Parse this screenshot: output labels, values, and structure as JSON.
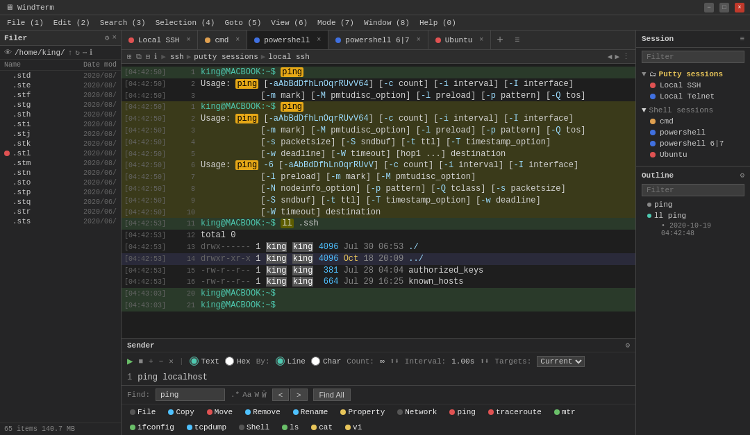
{
  "titlebar": {
    "title": "WindTerm",
    "min_label": "−",
    "max_label": "□",
    "close_label": "×"
  },
  "menubar": {
    "items": [
      "File (1)",
      "Edit (2)",
      "Search (3)",
      "Selection (4)",
      "Goto (5)",
      "View (6)",
      "Mode (7)",
      "Window (8)",
      "Help (0)"
    ]
  },
  "filepanel": {
    "title": "Filer",
    "path": "/home/king/",
    "col_name": "Name",
    "col_date": "Date mod",
    "files": [
      {
        "name": ".std",
        "date": "2020/08/"
      },
      {
        "name": ".ste",
        "date": "2020/08/"
      },
      {
        "name": ".stf",
        "date": "2020/08/"
      },
      {
        "name": ".stg",
        "date": "2020/08/"
      },
      {
        "name": ".sth",
        "date": "2020/08/"
      },
      {
        "name": ".sti",
        "date": "2020/08/"
      },
      {
        "name": ".stj",
        "date": "2020/08/"
      },
      {
        "name": ".stk",
        "date": "2020/08/"
      },
      {
        "name": ".stl",
        "date": "2020/08/",
        "dot": true
      },
      {
        "name": ".stm",
        "date": "2020/08/"
      },
      {
        "name": ".stn",
        "date": "2020/06/"
      },
      {
        "name": ".sto",
        "date": "2020/06/"
      },
      {
        "name": ".stp",
        "date": "2020/06/"
      },
      {
        "name": ".stq",
        "date": "2020/06/"
      },
      {
        "name": ".str",
        "date": "2020/06/"
      },
      {
        "name": ".sts",
        "date": "2020/06/"
      }
    ],
    "status": "65 items 140.7 MB"
  },
  "tabs": [
    {
      "label": "Local SSH",
      "color": "#e05252",
      "active": false
    },
    {
      "label": "cmd",
      "color": "#e0a050",
      "active": false
    },
    {
      "label": "powershell",
      "color": "#4070e0",
      "active": true
    },
    {
      "label": "powershell 6|7",
      "color": "#4070e0",
      "active": false
    },
    {
      "label": "Ubuntu",
      "color": "#e05252",
      "active": false
    }
  ],
  "toolbar": {
    "breadcrumb": [
      "ssh",
      "putty sessions",
      "local ssh"
    ]
  },
  "terminal_lines": [
    {
      "time": "[04:42:50]",
      "num": "1",
      "content": "king@MACBOOK:~$ ping",
      "type": "prompt_ping"
    },
    {
      "time": "[04:42:50]",
      "num": "2",
      "content": "Usage: ping [-aAbBdDfhLnOqrRUvV64] [-c count] [-i interval] [-I interface]",
      "type": "normal"
    },
    {
      "time": "[04:42:50]",
      "num": "3",
      "content": "            [-m mark] [-M pmtudisc_option] [-l preload] [-p pattern] [-Q tos]",
      "type": "normal"
    },
    {
      "time": "[04:42:50]",
      "num": "1",
      "content": "king@MACBOOK:~$ ping",
      "type": "prompt_ping2"
    },
    {
      "time": "[04:42:50]",
      "num": "2",
      "content": "Usage: ping [-aAbBdDfhLnOqrRUvV64] [-c count] [-i interval] [-I interface]",
      "type": "normal2"
    },
    {
      "time": "[04:42:50]",
      "num": "3",
      "content": "            [-m mark] [-M pmtudisc_option] [-l preload] [-p pattern] [-Q tos]",
      "type": "normal2"
    },
    {
      "time": "[04:42:50]",
      "num": "4",
      "content": "            [-s packetsize] [-S sndbuf] [-t ttl] [-T timestamp_option]",
      "type": "normal2"
    },
    {
      "time": "[04:42:50]",
      "num": "5",
      "content": "            [-w deadline] [-W timeout] [hop1 ...] destination",
      "type": "normal2"
    },
    {
      "time": "[04:42:50]",
      "num": "6",
      "content": "Usage: ping -6 [-aAbBdDfhLnOqrRUvV] [-c count] [-i interval] [-I interface]",
      "type": "normal2"
    },
    {
      "time": "[04:42:50]",
      "num": "7",
      "content": "            [-l preload] [-m mark] [-M pmtudisc_option]",
      "type": "normal2"
    },
    {
      "time": "[04:42:50]",
      "num": "8",
      "content": "            [-N nodeinfo_option] [-p pattern] [-Q tclass] [-s packetsize]",
      "type": "normal2"
    },
    {
      "time": "[04:42:50]",
      "num": "9",
      "content": "            [-S sndbuf] [-t ttl] [-T timestamp_option] [-w deadline]",
      "type": "normal2"
    },
    {
      "time": "[04:42:50]",
      "num": "10",
      "content": "            [-W timeout] destination",
      "type": "normal2"
    },
    {
      "time": "[04:42:53]",
      "num": "11",
      "content": "king@MACBOOK:~$ ll .ssh",
      "type": "prompt_ll"
    },
    {
      "time": "[04:42:53]",
      "num": "12",
      "content": "total 0",
      "type": "normal"
    },
    {
      "time": "[04:42:53]",
      "num": "13",
      "content": "drwx------ 1 king king 4096 Jul 30 06:53 ./",
      "type": "normal_dir"
    },
    {
      "time": "[04:42:53]",
      "num": "14",
      "content": "drwxr-xr-x 1 king king 4096 Oct 18 20:09 ../",
      "type": "normal_dir2"
    },
    {
      "time": "[04:42:53]",
      "num": "15",
      "content": "-rw-r--r-- 1 king king  381 Jul 28 04:04 authorized_keys",
      "type": "normal"
    },
    {
      "time": "[04:42:53]",
      "num": "16",
      "content": "-rw-r--r-- 1 king king  664 Jul 29 16:25 known_hosts",
      "type": "normal"
    },
    {
      "time": "[04:43:03]",
      "num": "20",
      "content": "king@MACBOOK:~$",
      "type": "prompt_empty"
    },
    {
      "time": "[04:43:03]",
      "num": "21",
      "content": "king@MACBOOK:~$",
      "type": "prompt_empty2"
    }
  ],
  "sender": {
    "title": "Sender",
    "text_label": "Text",
    "hex_label": "Hex",
    "by_label": "By:",
    "line_label": "Line",
    "char_label": "Char",
    "count_label": "Count:",
    "interval_label": "Interval:",
    "interval_value": "1.00s",
    "targets_label": "Targets:",
    "targets_value": "Current",
    "line_number": "1",
    "input_value": "ping localhost"
  },
  "findbar": {
    "find_label": "Find:",
    "find_value": "ping",
    "regex_label": ".*",
    "case_label": "Aa",
    "word_label": "W",
    "regex2_label": "W̄",
    "prev_label": "<",
    "next_label": ">",
    "find_all_label": "Find All"
  },
  "bottom_toolbar": {
    "buttons": [
      {
        "label": "File",
        "color": "#555"
      },
      {
        "label": "Copy",
        "color": "#4fc1ff"
      },
      {
        "label": "Move",
        "color": "#e05252"
      },
      {
        "label": "Remove",
        "color": "#4fc1ff"
      },
      {
        "label": "Rename",
        "color": "#4fc1ff"
      },
      {
        "label": "Property",
        "color": "#e8c55a"
      },
      {
        "label": "Network",
        "color": "#555"
      },
      {
        "label": "ping",
        "color": "#e05252"
      },
      {
        "label": "traceroute",
        "color": "#e05252"
      },
      {
        "label": "mtr",
        "color": "#6abf69"
      },
      {
        "label": "ifconfig",
        "color": "#6abf69"
      },
      {
        "label": "tcpdump",
        "color": "#4fc1ff"
      },
      {
        "label": "Shell",
        "color": "#555"
      },
      {
        "label": "ls",
        "color": "#6abf69"
      },
      {
        "label": "cat",
        "color": "#e8c55a"
      },
      {
        "label": "vi",
        "color": "#e8c55a"
      }
    ]
  },
  "right_panel": {
    "session_title": "Session",
    "filter_placeholder": "Filter",
    "putty_group": "Putty sessions",
    "putty_items": [
      {
        "label": "Local SSH",
        "color": "#e05252"
      },
      {
        "label": "Local Telnet",
        "color": "#4070e0"
      }
    ],
    "shell_group": "Shell sessions",
    "shell_items": [
      {
        "label": "cmd",
        "color": "#e0a050"
      },
      {
        "label": "powershell",
        "color": "#4070e0"
      },
      {
        "label": "powershell 6|7",
        "color": "#4070e0"
      },
      {
        "label": "Ubuntu",
        "color": "#e05252"
      }
    ],
    "outline_title": "Outline",
    "outline_filter_placeholder": "Filter",
    "outline_items": [
      {
        "label": "ping",
        "active": false
      },
      {
        "label": "ll ping",
        "active": true
      },
      {
        "detail": "2020-10-19 04:42:48"
      }
    ]
  }
}
